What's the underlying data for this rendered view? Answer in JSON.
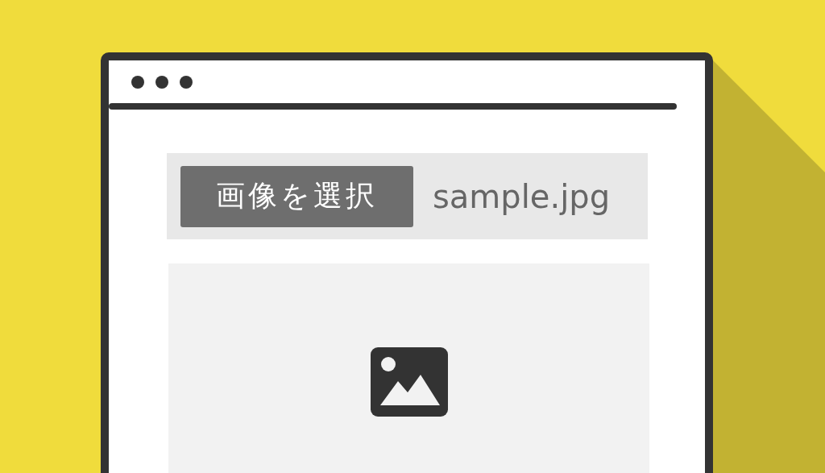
{
  "file_picker": {
    "button": "画像を選択",
    "file_name": "sample.jpg"
  }
}
